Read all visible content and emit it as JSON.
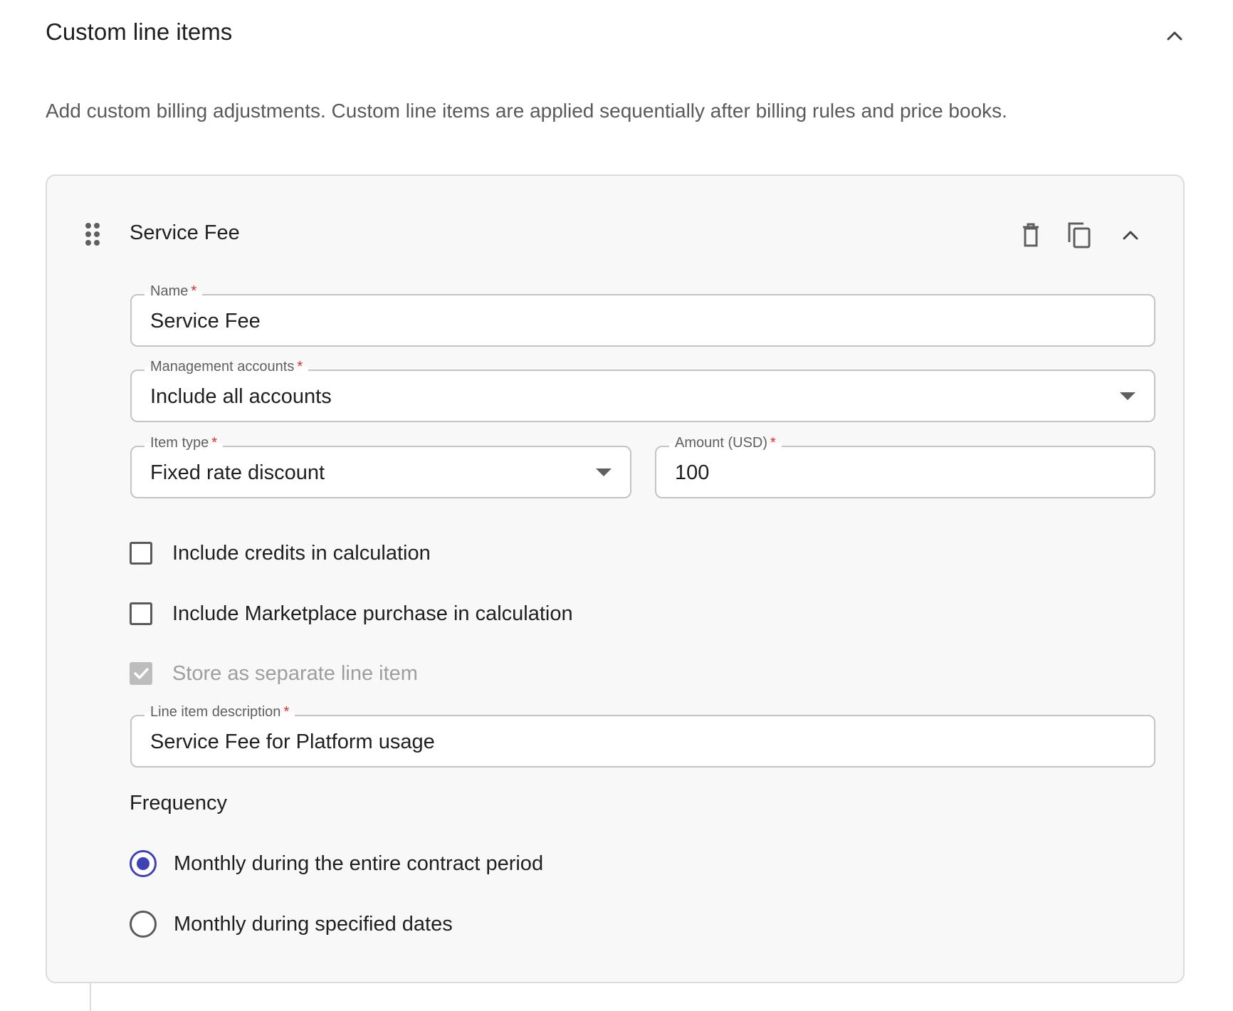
{
  "section": {
    "title": "Custom line items",
    "description": "Add custom billing adjustments. Custom line items are applied sequentially after billing rules and price books."
  },
  "item": {
    "title": "Service Fee",
    "fields": {
      "name": {
        "label": "Name",
        "required": "*",
        "value": "Service Fee"
      },
      "management_accounts": {
        "label": "Management accounts",
        "required": "*",
        "value": "Include all accounts"
      },
      "item_type": {
        "label": "Item type",
        "required": "*",
        "value": "Fixed rate discount"
      },
      "amount": {
        "label": "Amount (USD)",
        "required": "*",
        "value": "100"
      },
      "line_item_description": {
        "label": "Line item description",
        "required": "*",
        "value": "Service Fee for Platform usage"
      }
    },
    "checkboxes": [
      {
        "label": "Include credits in calculation",
        "checked": false,
        "disabled": false
      },
      {
        "label": "Include Marketplace purchase in calculation",
        "checked": false,
        "disabled": false
      },
      {
        "label": "Store as separate line item",
        "checked": true,
        "disabled": true
      }
    ],
    "frequency": {
      "title": "Frequency",
      "options": [
        {
          "label": "Monthly during the entire contract period",
          "selected": true
        },
        {
          "label": "Monthly during specified dates",
          "selected": false
        }
      ]
    }
  },
  "icons": {
    "collapse": "chevron-up-icon",
    "drag": "drag-handle-icon",
    "delete": "trash-icon",
    "duplicate": "copy-icon",
    "dropdown": "caret-down-icon"
  },
  "colors": {
    "accent": "#3f41b5",
    "required": "#d93025",
    "card_background": "#f8f8f8",
    "border": "#c4c4c4"
  }
}
